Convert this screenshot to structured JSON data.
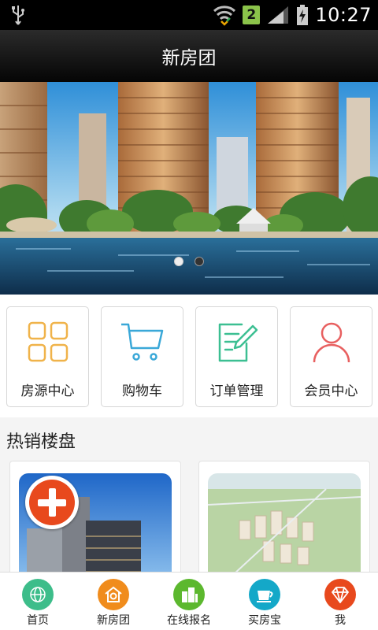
{
  "status_bar": {
    "sim_slot": "2",
    "time": "10:27"
  },
  "header": {
    "title": "新房团"
  },
  "banner": {
    "slide_count": 2,
    "active_slide": 1
  },
  "categories": [
    {
      "label": "房源中心",
      "icon": "grid-icon",
      "color": "#f0b34a"
    },
    {
      "label": "购物车",
      "icon": "cart-icon",
      "color": "#3aa8d8"
    },
    {
      "label": "订单管理",
      "icon": "edit-note-icon",
      "color": "#3cbf92"
    },
    {
      "label": "会员中心",
      "icon": "user-icon",
      "color": "#e86060"
    }
  ],
  "section": {
    "title": "热销楼盘"
  },
  "bottom_nav": [
    {
      "label": "首页",
      "icon": "globe-icon",
      "color": "#3dbd8a"
    },
    {
      "label": "新房团",
      "icon": "house-coin-icon",
      "color": "#f08c1c"
    },
    {
      "label": "在线报名",
      "icon": "buildings-icon",
      "color": "#5cb82e"
    },
    {
      "label": "买房宝",
      "icon": "cup-icon",
      "color": "#14a8c8"
    },
    {
      "label": "我",
      "icon": "diamond-icon",
      "color": "#e8491d"
    }
  ]
}
